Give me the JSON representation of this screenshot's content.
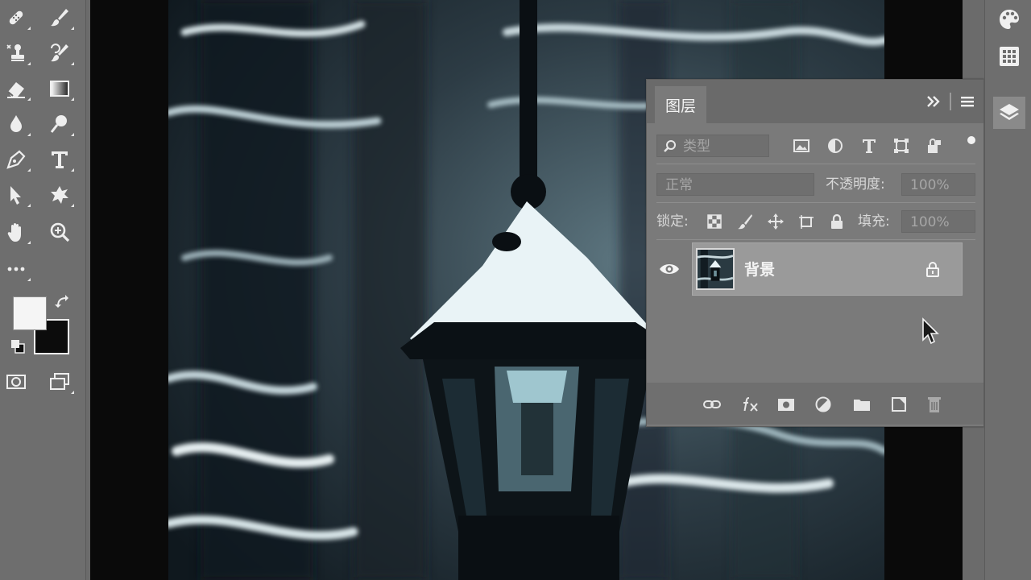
{
  "layers_panel": {
    "tab_label": "图层",
    "filter": {
      "placeholder": "类型"
    },
    "blend_mode": "正常",
    "opacity_label": "不透明度:",
    "opacity_value": "100%",
    "lock_label": "锁定:",
    "fill_label": "填充:",
    "fill_value": "100%",
    "layers": [
      {
        "name": "背景",
        "visible": true,
        "locked": true
      }
    ]
  },
  "colors": {
    "foreground": "#f5f5f5",
    "background": "#0c0c0c",
    "panel_bg": "#7a7a7a",
    "toolbar_bg": "#6e6e6e"
  },
  "icons": {
    "toolbar": [
      "healing-brush-icon",
      "brush-icon",
      "clone-stamp-icon",
      "history-brush-icon",
      "eraser-icon",
      "gradient-icon",
      "blur-icon",
      "dodge-icon",
      "pen-icon",
      "type-icon",
      "path-selection-icon",
      "custom-shape-icon",
      "hand-icon",
      "zoom-icon",
      "more-tools-icon",
      "quick-mask-icon",
      "screen-mode-icon"
    ],
    "dock": [
      "swatches-icon",
      "grid-icon",
      "layers-icon"
    ],
    "footer": [
      "link-layers-icon",
      "fx-icon",
      "layer-mask-icon",
      "adjustment-layer-icon",
      "group-folder-icon",
      "new-layer-icon",
      "delete-icon"
    ]
  }
}
